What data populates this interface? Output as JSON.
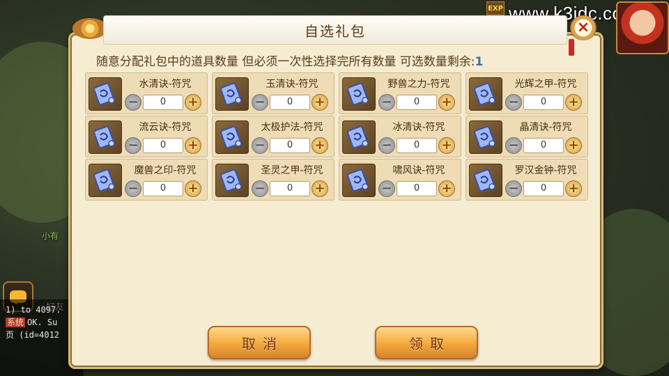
{
  "scene": {
    "exp_label": "EXP",
    "watermark": "www.k3idc.com",
    "side_hint": "小有",
    "friend_label": "好友",
    "log_lines": [
      {
        "tag": "",
        "text": "1) to 4097."
      },
      {
        "tag": "系统",
        "text": "OK. Su"
      },
      {
        "tag": "",
        "text": "页 (id=4012"
      }
    ]
  },
  "dialog": {
    "title": "自选礼包",
    "close_label": "×",
    "instruction": "随意分配礼包中的道具数量 但必须一次性选择完所有数量  可选数量剩余:",
    "remaining": "1",
    "items": [
      {
        "name": "水清诀-符咒",
        "qty": "0"
      },
      {
        "name": "玉清诀-符咒",
        "qty": "0"
      },
      {
        "name": "野兽之力-符咒",
        "qty": "0"
      },
      {
        "name": "光辉之甲-符咒",
        "qty": "0"
      },
      {
        "name": "流云诀-符咒",
        "qty": "0"
      },
      {
        "name": "太极护法-符咒",
        "qty": "0"
      },
      {
        "name": "冰清诀-符咒",
        "qty": "0"
      },
      {
        "name": "晶清诀-符咒",
        "qty": "0"
      },
      {
        "name": "魔兽之印-符咒",
        "qty": "0"
      },
      {
        "name": "圣灵之甲-符咒",
        "qty": "0"
      },
      {
        "name": "啸风诀-符咒",
        "qty": "0"
      },
      {
        "name": "罗汉金钟-符咒",
        "qty": "0"
      }
    ],
    "minus_label": "−",
    "plus_label": "+",
    "cancel_label": "取消",
    "confirm_label": "领取"
  }
}
